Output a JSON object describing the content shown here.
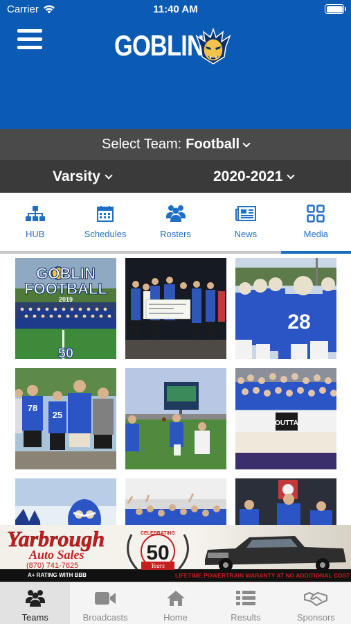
{
  "status_bar": {
    "carrier": "Carrier",
    "time": "11:40 AM"
  },
  "header": {
    "brand": "GOBLINS",
    "brand_color": "#0b5bb4"
  },
  "team_selector": {
    "prefix": "Select Team:",
    "team": "Football"
  },
  "filters": {
    "level": "Varsity",
    "season": "2020-2021"
  },
  "tabs": [
    {
      "label": "HUB",
      "icon": "hub-icon"
    },
    {
      "label": "Schedules",
      "icon": "calendar-icon"
    },
    {
      "label": "Rosters",
      "icon": "people-icon"
    },
    {
      "label": "News",
      "icon": "news-icon"
    },
    {
      "label": "Media",
      "icon": "grid-icon",
      "active": true
    }
  ],
  "media": {
    "tile1": {
      "title_line1": "GOBLIN",
      "title_line2": "FOOTBALL",
      "year": "2019",
      "field_number": "50"
    },
    "tile3": {
      "jersey_number": "28"
    },
    "tile4": {
      "jersey_numbers": [
        "78",
        "25"
      ]
    },
    "tile6": {
      "sign_text": "OUTTA"
    }
  },
  "ad": {
    "name_line1": "Yarbrough",
    "name_line2": "Auto Sales",
    "phone": "(870) 741-7625",
    "rating": "A+ RATING WITH BBB",
    "celebrating": "CELEBRATING",
    "anniversary_number": "50",
    "anniversary_word": "Years",
    "warranty": "LIFETIME POWERTRAIN WARANTY AT NO ADDITIONAL COST"
  },
  "bottom_nav": [
    {
      "label": "Teams",
      "icon": "teams-icon",
      "active": true
    },
    {
      "label": "Broadcasts",
      "icon": "video-camera-icon"
    },
    {
      "label": "Home",
      "icon": "home-icon"
    },
    {
      "label": "Results",
      "icon": "list-icon"
    },
    {
      "label": "Sponsors",
      "icon": "handshake-icon"
    }
  ]
}
